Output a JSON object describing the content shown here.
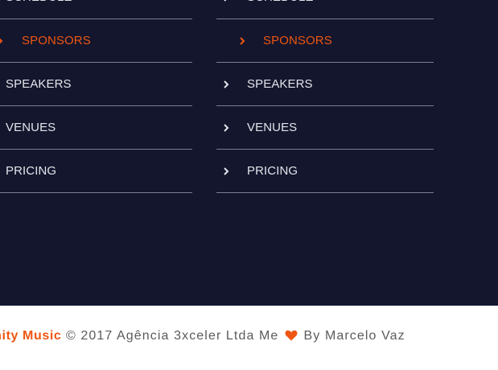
{
  "menus": [
    {
      "items": [
        {
          "label": "Schedule",
          "active": false
        },
        {
          "label": "Sponsors",
          "active": true
        },
        {
          "label": "Speakers",
          "active": false
        },
        {
          "label": "Venues",
          "active": false
        },
        {
          "label": "Pricing",
          "active": false
        }
      ]
    },
    {
      "items": [
        {
          "label": "Schedule",
          "active": false
        },
        {
          "label": "Sponsors",
          "active": true
        },
        {
          "label": "Speakers",
          "active": false
        },
        {
          "label": "Venues",
          "active": false
        },
        {
          "label": "Pricing",
          "active": false
        }
      ]
    }
  ],
  "footer": {
    "brand": "Unity Music",
    "copyright": "© 2017 Agência 3xceler Ltda Me",
    "by": "By Marcelo Vaz"
  },
  "colors": {
    "background": "#13162d",
    "accent": "#ef5612",
    "menu_text": "#e3e4ea",
    "divider": "#7b7e8e",
    "footer_text": "#5b5b5b"
  },
  "icons": {
    "menu_bullet": "chevron-right-icon",
    "footer_love": "heart-icon"
  }
}
